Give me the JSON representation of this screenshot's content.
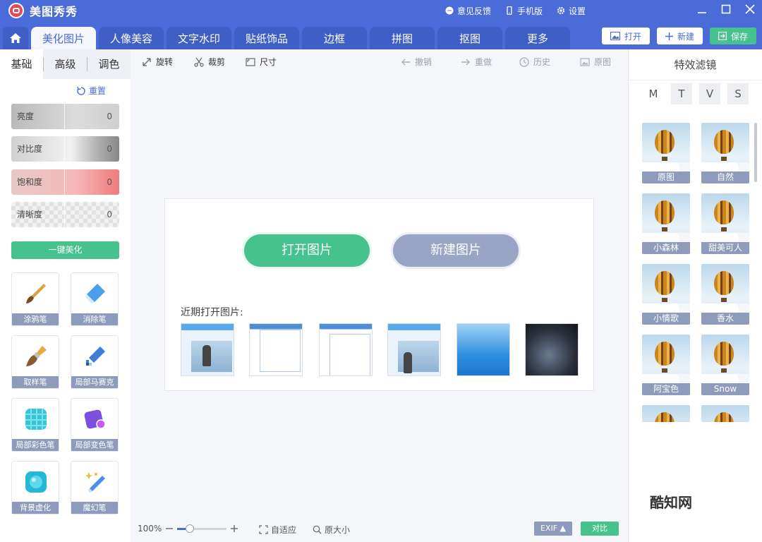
{
  "titlebar": {
    "app_title": "美图秀秀",
    "feedback": "意见反馈",
    "mobile": "手机版",
    "settings": "设置"
  },
  "menubar": {
    "tabs": [
      "美化图片",
      "人像美容",
      "文字水印",
      "贴纸饰品",
      "边框",
      "拼图",
      "抠图",
      "更多"
    ],
    "active_tab": "美化图片",
    "open_label": "打开",
    "new_label": "新建",
    "save_label": "保存"
  },
  "left_panel": {
    "subtabs": [
      "基础",
      "高级",
      "调色"
    ],
    "reset_label": "重置",
    "sliders": [
      {
        "label": "亮度",
        "value": "0"
      },
      {
        "label": "对比度",
        "value": "0"
      },
      {
        "label": "饱和度",
        "value": "0"
      },
      {
        "label": "清晰度",
        "value": "0"
      }
    ],
    "beautify_label": "一键美化",
    "tools": [
      "涂鸦笔",
      "消除笔",
      "取样笔",
      "局部马赛克",
      "局部彩色笔",
      "局部变色笔",
      "背景虚化",
      "魔幻笔"
    ]
  },
  "toolbar": {
    "rotate": "旋转",
    "crop": "裁剪",
    "size": "尺寸",
    "undo": "撤销",
    "redo": "重做",
    "history": "历史",
    "original": "原图"
  },
  "canvas": {
    "open_image": "打开图片",
    "new_image": "新建图片",
    "recent_label": "近期打开图片:"
  },
  "right_panel": {
    "title": "特效滤镜",
    "filter_tabs": [
      "M",
      "T",
      "V",
      "S"
    ],
    "filters": [
      "原图",
      "自然",
      "小森林",
      "甜美可人",
      "小情歌",
      "香水",
      "阿宝色",
      "Snow"
    ],
    "watermark": "酷知网"
  },
  "bottombar": {
    "zoom_level": "100%",
    "zoom_fraction": 0.25,
    "fit_label": "自适应",
    "original_size": "原大小",
    "exif_label": "EXIF ▲",
    "compare_label": "对比"
  },
  "colors": {
    "brand_blue": "#4a6bd8",
    "accent_green": "#46c28e",
    "label_gray": "#8f9bbd"
  }
}
